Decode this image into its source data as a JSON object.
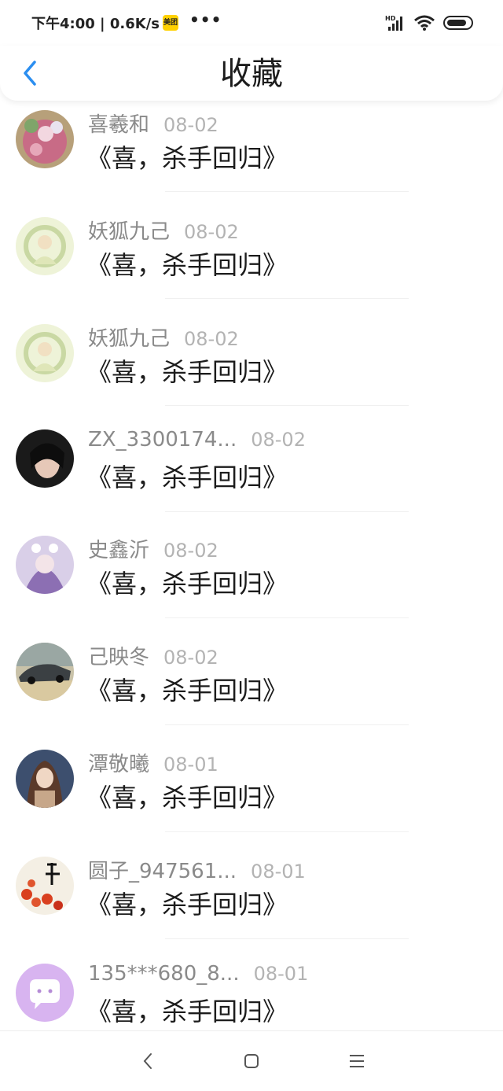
{
  "status_bar": {
    "time_speed": "下午4:00 | 0.6K/s",
    "app_badge": "美团",
    "more": "•••"
  },
  "header": {
    "title": "收藏"
  },
  "items": [
    {
      "name": "喜羲和",
      "date": "08-02",
      "content": "《喜，杀手回归》",
      "avatar_colors": [
        "#c86b86",
        "#7fa56a"
      ]
    },
    {
      "name": "妖狐九己",
      "date": "08-02",
      "content": "《喜，杀手回归》",
      "avatar_colors": [
        "#eef3d8",
        "#c9d8a3"
      ]
    },
    {
      "name": "妖狐九己",
      "date": "08-02",
      "content": "《喜，杀手回归》",
      "avatar_colors": [
        "#eef3d8",
        "#c9d8a3"
      ]
    },
    {
      "name": "ZX_3300174...",
      "date": "08-02",
      "content": "《喜，杀手回归》",
      "avatar_colors": [
        "#1a1a1a",
        "#e6c8b8"
      ]
    },
    {
      "name": "史鑫沂",
      "date": "08-02",
      "content": "《喜，杀手回归》",
      "avatar_colors": [
        "#d9cfe8",
        "#8c6fb3"
      ]
    },
    {
      "name": "己映冬",
      "date": "08-02",
      "content": "《喜，杀手回归》",
      "avatar_colors": [
        "#9aa7a3",
        "#d9c9a0"
      ]
    },
    {
      "name": "潭敬曦",
      "date": "08-01",
      "content": "《喜，杀手回归》",
      "avatar_colors": [
        "#3d4f6e",
        "#c7a78a"
      ]
    },
    {
      "name": "圆子_947561...",
      "date": "08-01",
      "content": "《喜，杀手回归》",
      "avatar_colors": [
        "#f4efe4",
        "#d9401f"
      ]
    },
    {
      "name": "135***680_8...",
      "date": "08-01",
      "content": "《喜，杀手回归》",
      "avatar_colors": [
        "#d8b4f0",
        "#ffffff"
      ]
    }
  ]
}
